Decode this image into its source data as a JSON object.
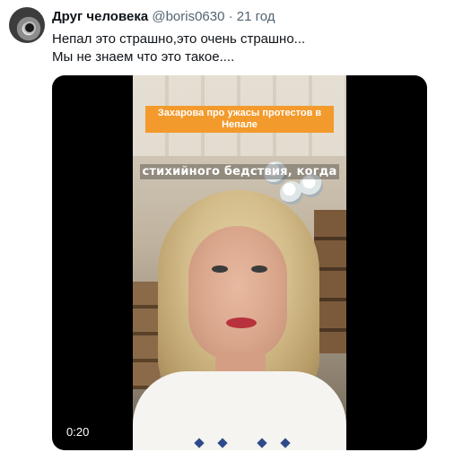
{
  "author": {
    "name": "Друг человека",
    "handle": "@boris0630",
    "separator": "·",
    "time": "21 год"
  },
  "tweet": {
    "lines": [
      "Непал это страшно,это очень страшно...",
      "Мы не знаем что это такое...."
    ]
  },
  "video": {
    "title_overlay": "Захарова про ужасы протестов в Непале",
    "caption": "стихийного бедствия, когда",
    "duration": "0:20"
  }
}
